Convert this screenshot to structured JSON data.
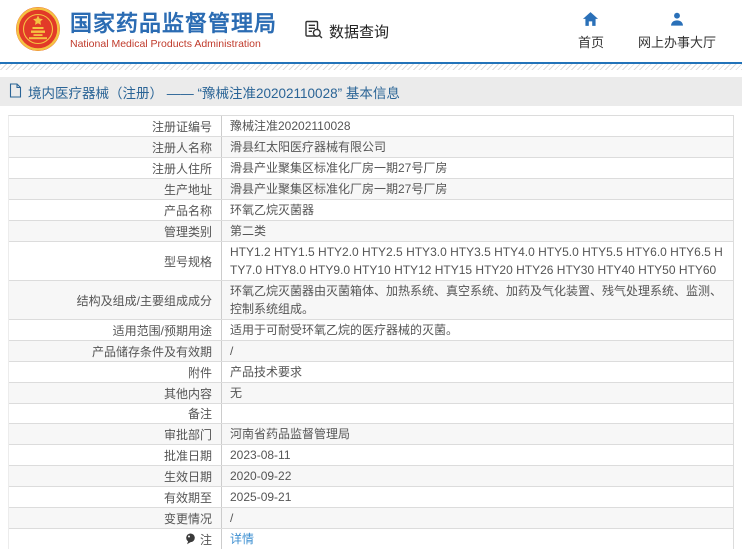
{
  "header": {
    "org_name": "国家药品监督管理局",
    "org_name_en": "National Medical Products Administration",
    "data_query_label": "数据查询",
    "nav": [
      {
        "label": "首页",
        "icon": "home-icon"
      },
      {
        "label": "网上办事大厅",
        "icon": "user-icon"
      }
    ]
  },
  "breadcrumb": {
    "label": "境内医疗器械（注册） —— “豫械注准20202110028” 基本信息"
  },
  "table": {
    "rows": [
      {
        "label": "注册证编号",
        "value": "豫械注准20202110028"
      },
      {
        "label": "注册人名称",
        "value": "滑县红太阳医疗器械有限公司"
      },
      {
        "label": "注册人住所",
        "value": "滑县产业聚集区标准化厂房一期27号厂房"
      },
      {
        "label": "生产地址",
        "value": "滑县产业聚集区标准化厂房一期27号厂房"
      },
      {
        "label": "产品名称",
        "value": "环氧乙烷灭菌器"
      },
      {
        "label": "管理类别",
        "value": "第二类"
      },
      {
        "label": "型号规格",
        "value": "HTY1.2 HTY1.5 HTY2.0 HTY2.5 HTY3.0 HTY3.5 HTY4.0 HTY5.0 HTY5.5 HTY6.0 HTY6.5 HTY7.0 HTY8.0 HTY9.0 HTY10 HTY12 HTY15 HTY20 HTY26 HTY30 HTY40 HTY50 HTY60"
      },
      {
        "label": "结构及组成/主要组成成分",
        "value": "环氧乙烷灭菌器由灭菌箱体、加热系统、真空系统、加药及气化装置、残气处理系统、监测、控制系统组成。"
      },
      {
        "label": "适用范围/预期用途",
        "value": "适用于可耐受环氧乙烷的医疗器械的灭菌。"
      },
      {
        "label": "产品储存条件及有效期",
        "value": "/"
      },
      {
        "label": "附件",
        "value": "产品技术要求"
      },
      {
        "label": "其他内容",
        "value": "无"
      },
      {
        "label": "备注",
        "value": ""
      },
      {
        "label": "审批部门",
        "value": "河南省药品监督管理局"
      },
      {
        "label": "批准日期",
        "value": "2023-08-11"
      },
      {
        "label": "生效日期",
        "value": "2020-09-22"
      },
      {
        "label": "有效期至",
        "value": "2025-09-21"
      },
      {
        "label": "变更情况",
        "value": "/"
      },
      {
        "label": "注",
        "value": "详情",
        "link": true,
        "icon": "note-icon"
      }
    ]
  },
  "colors": {
    "brand_blue": "#2b6cb3",
    "brand_red": "#c03a2b",
    "nav_icon_blue": "#2a70b8",
    "breadcrumb_blue": "#2a6496",
    "link_blue": "#3d8fd1",
    "alt_row": "#f7f7f7"
  }
}
